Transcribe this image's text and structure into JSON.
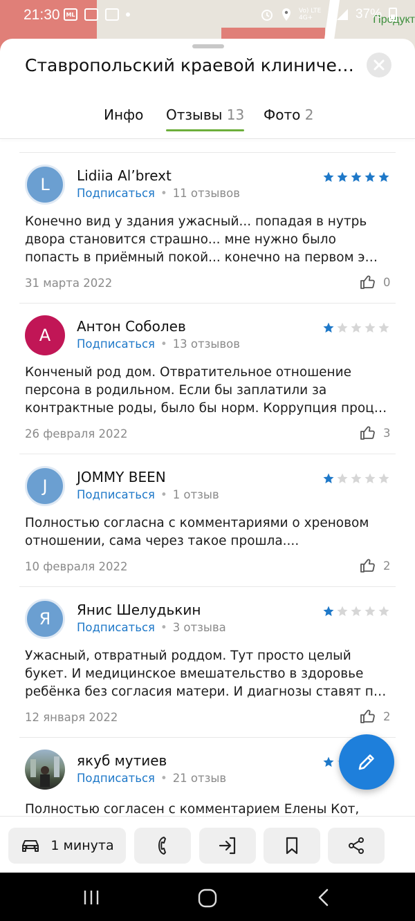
{
  "status_bar": {
    "time": "21:30",
    "battery": "37%",
    "network": "Vo) LTE 4G+",
    "left_icons": [
      "mom-life-icon",
      "image-icon",
      "calendar-icon"
    ],
    "right_icons": [
      "alarm-icon",
      "location-icon",
      "signal-icon",
      "battery-icon"
    ]
  },
  "map": {
    "visible_label": "Продукт"
  },
  "sheet": {
    "title": "Ставропольский краевой клиниче…"
  },
  "tabs": [
    {
      "label": "Инфо",
      "count": ""
    },
    {
      "label": "Отзывы",
      "count": "13",
      "active": true
    },
    {
      "label": "Фото",
      "count": "2"
    }
  ],
  "subscribe_label": "Подписаться",
  "reviews": [
    {
      "author": "Lidiia Al’brext",
      "initial": "L",
      "avatar_color": "#6b9fd1",
      "reviews_count": "11 отзывов",
      "rating": 5,
      "text": "Конечно вид у здания ужасный... попадая в нутрь двора становится страшно... мне нужно было попасть в приёмный покой... конечно на первом э…",
      "date": "31 марта 2022",
      "likes": "0"
    },
    {
      "author": "Антон Соболев",
      "initial": "А",
      "avatar_color": "#c11656",
      "reviews_count": "13 отзывов",
      "rating": 1,
      "text": "Конченый род дом. Отвратительное отношение персона в родильном. Если бы заплатили за контрактные роды, было бы норм. Коррупция проц…",
      "date": "26 февраля 2022",
      "likes": "3"
    },
    {
      "author": "JOMMY BEEN",
      "initial": "J",
      "avatar_color": "#6b9fd1",
      "reviews_count": "1 отзыв",
      "rating": 1,
      "text": "Полностью согласна с комментариями о хреновом отношении, сама через такое прошла....",
      "date": "10 февраля 2022",
      "likes": "2"
    },
    {
      "author": "Янис Шелудькин",
      "initial": "Я",
      "avatar_color": "#6b9fd1",
      "reviews_count": "3 отзыва",
      "rating": 1,
      "text": "Ужасный, отвратный роддом. Тут просто целый букет. И медицинское вмешательство в здоровье ребёнка без согласия матери. И диагнозы ставят п…",
      "date": "12 января 2022",
      "likes": "2"
    },
    {
      "author": "якуб мутиев",
      "initial": "",
      "avatar_color": "photo",
      "reviews_count": "21 отзыв",
      "rating": 1,
      "text": "Полностью согласен с комментарием Елены Кот,",
      "date": "",
      "likes": ""
    }
  ],
  "bottom_actions": {
    "route_label": "1 минута",
    "icons": [
      "car-icon",
      "phone-icon",
      "enter-icon",
      "bookmark-icon",
      "share-icon"
    ]
  },
  "fab_icon": "pencil-icon",
  "colors": {
    "accent_blue": "#1e78c8",
    "star_active": "#1e78c8",
    "star_inactive": "#d6d6d6",
    "tab_underline": "#6cae3a",
    "fab": "#1e7fdb"
  }
}
